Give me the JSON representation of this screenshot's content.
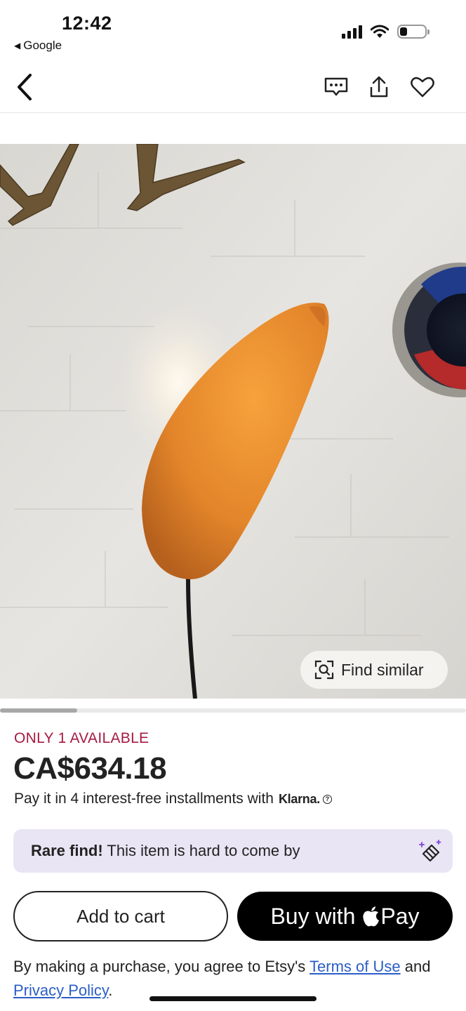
{
  "status_bar": {
    "time": "12:42",
    "back_app_label": "Google",
    "icons": [
      "signal-icon",
      "wifi-icon",
      "battery-icon"
    ]
  },
  "nav": {
    "icons": [
      "back-chevron-icon",
      "message-icon",
      "share-icon",
      "heart-icon"
    ]
  },
  "product": {
    "find_similar_label": "Find similar",
    "availability": "ONLY 1 AVAILABLE",
    "price": "CA$634.18",
    "installments_text": "Pay it in 4 interest-free installments with",
    "klarna_label": "Klarna.",
    "help_icon": "?"
  },
  "carousel": {
    "position_fraction": 0.17
  },
  "rare_banner": {
    "bold": "Rare find!",
    "text": "This item is hard to come by",
    "icon": "sparkle-diamond-icon"
  },
  "actions": {
    "add_to_cart_label": "Add to cart",
    "buy_label": "Buy with",
    "pay_label": "Pay"
  },
  "legal": {
    "prefix": "By making a purchase, you agree to Etsy's",
    "terms_link": "Terms of Use",
    "conjunction": "and",
    "privacy_link": "Privacy Policy",
    "suffix": "."
  },
  "colors": {
    "availability": "#a61a41",
    "link": "#2b5ec6",
    "rare_banner_bg": "#e9e5f4",
    "lamp": "#e98f2e"
  }
}
